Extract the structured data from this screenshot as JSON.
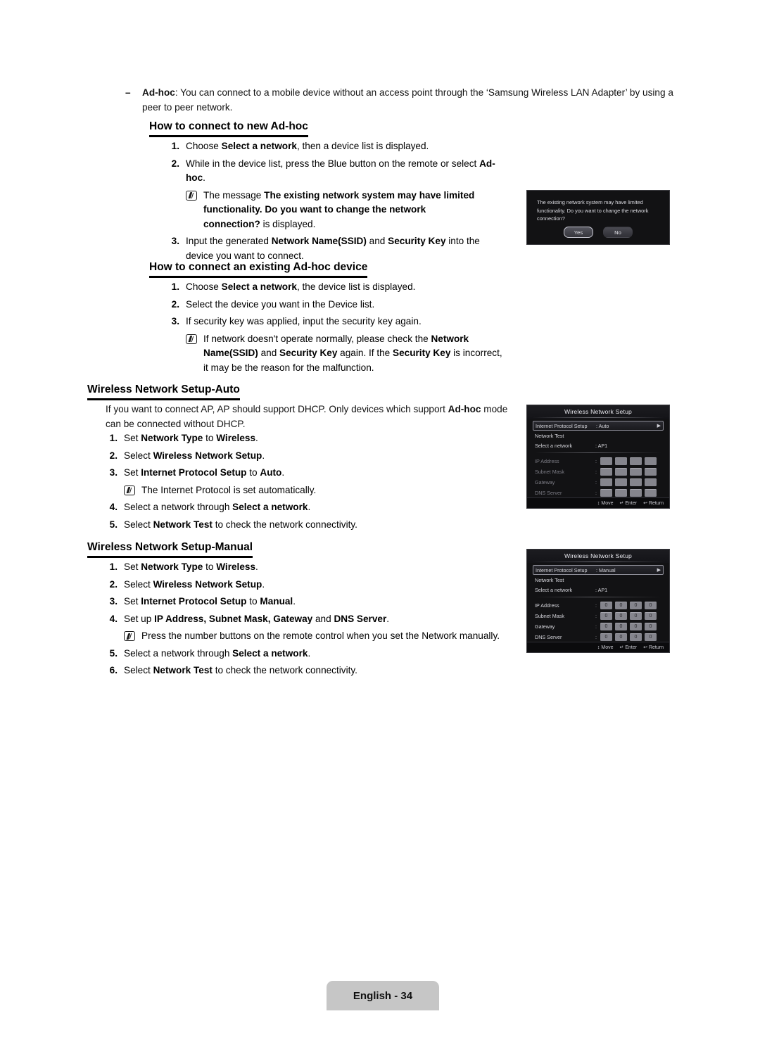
{
  "document": {
    "footer_label": "English - 34"
  },
  "intro": {
    "dash": "–",
    "term": "Ad-hoc",
    "text_1": ": You can connect to a mobile device without an access point through the ‘Samsung Wireless LAN Adapter’ by using a peer to peer network."
  },
  "section_new_adhoc": {
    "heading": "How to connect to new Ad-hoc",
    "items": [
      {
        "num": "1.",
        "parts": [
          {
            "t": "Choose ",
            "b": false
          },
          {
            "t": "Select a network",
            "b": true
          },
          {
            "t": ", then a device list is displayed.",
            "b": false
          }
        ]
      },
      {
        "num": "2.",
        "parts": [
          {
            "t": "While in the device list, press the Blue button on the remote or select ",
            "b": false
          },
          {
            "t": "Ad-hoc",
            "b": true
          },
          {
            "t": ".",
            "b": false
          }
        ]
      }
    ],
    "note": {
      "parts": [
        {
          "t": "The message ",
          "b": false
        },
        {
          "t": "The existing network system may have limited functionality. Do you want to change the network connection?",
          "b": true
        },
        {
          "t": " is displayed.",
          "b": false
        }
      ]
    },
    "item_3": {
      "num": "3.",
      "parts": [
        {
          "t": "Input the generated ",
          "b": false
        },
        {
          "t": "Network Name(SSID)",
          "b": true
        },
        {
          "t": " and ",
          "b": false
        },
        {
          "t": "Security Key",
          "b": true
        },
        {
          "t": " into the device you want to connect.",
          "b": false
        }
      ]
    }
  },
  "dialog": {
    "message": "The existing network system may have limited functionality. Do you want to change the network connection?",
    "buttons": [
      {
        "label": "Yes",
        "focused": true
      },
      {
        "label": "No",
        "focused": false
      }
    ]
  },
  "section_existing_adhoc": {
    "heading": "How to connect an existing Ad-hoc device",
    "items": [
      {
        "num": "1.",
        "parts": [
          {
            "t": "Choose ",
            "b": false
          },
          {
            "t": "Select a network",
            "b": true
          },
          {
            "t": ", the device list is displayed.",
            "b": false
          }
        ]
      },
      {
        "num": "2.",
        "parts": [
          {
            "t": "Select the device you want in the Device list.",
            "b": false
          }
        ]
      },
      {
        "num": "3.",
        "parts": [
          {
            "t": "If security key was applied, input the security key again.",
            "b": false
          }
        ]
      }
    ],
    "note": {
      "parts": [
        {
          "t": "If network doesn't operate normally, please check the ",
          "b": false
        },
        {
          "t": "Network Name(SSID)",
          "b": true
        },
        {
          "t": " and ",
          "b": false
        },
        {
          "t": "Security Key",
          "b": true
        },
        {
          "t": " again. If the ",
          "b": false
        },
        {
          "t": "Security Key",
          "b": true
        },
        {
          "t": " is incorrect, it may be the reason for the malfunction.",
          "b": false
        }
      ]
    }
  },
  "section_auto": {
    "heading": "Wireless Network Setup-Auto",
    "intro": [
      {
        "t": "If you want to connect AP, AP should support DHCP. Only devices which support ",
        "b": false
      },
      {
        "t": "Ad-hoc",
        "b": true
      },
      {
        "t": " mode can be connected without DHCP.",
        "b": false
      }
    ],
    "items": [
      {
        "num": "1.",
        "parts": [
          {
            "t": "Set ",
            "b": false
          },
          {
            "t": "Network Type",
            "b": true
          },
          {
            "t": " to ",
            "b": false
          },
          {
            "t": "Wireless",
            "b": true
          },
          {
            "t": ".",
            "b": false
          }
        ]
      },
      {
        "num": "2.",
        "parts": [
          {
            "t": "Select ",
            "b": false
          },
          {
            "t": "Wireless Network Setup",
            "b": true
          },
          {
            "t": ".",
            "b": false
          }
        ]
      },
      {
        "num": "3.",
        "parts": [
          {
            "t": "Set ",
            "b": false
          },
          {
            "t": "Internet Protocol Setup",
            "b": true
          },
          {
            "t": " to ",
            "b": false
          },
          {
            "t": "Auto",
            "b": true
          },
          {
            "t": ".",
            "b": false
          }
        ]
      }
    ],
    "note": {
      "parts": [
        {
          "t": "The Internet Protocol is set automatically.",
          "b": false
        }
      ]
    },
    "items_tail": [
      {
        "num": "4.",
        "parts": [
          {
            "t": "Select a network through ",
            "b": false
          },
          {
            "t": "Select a network",
            "b": true
          },
          {
            "t": ".",
            "b": false
          }
        ]
      },
      {
        "num": "5.",
        "parts": [
          {
            "t": "Select ",
            "b": false
          },
          {
            "t": "Network Test",
            "b": true
          },
          {
            "t": " to check the network connectivity.",
            "b": false
          }
        ]
      }
    ]
  },
  "section_manual": {
    "heading": "Wireless Network Setup-Manual",
    "items": [
      {
        "num": "1.",
        "parts": [
          {
            "t": "Set ",
            "b": false
          },
          {
            "t": "Network Type",
            "b": true
          },
          {
            "t": " to ",
            "b": false
          },
          {
            "t": "Wireless",
            "b": true
          },
          {
            "t": ".",
            "b": false
          }
        ]
      },
      {
        "num": "2.",
        "parts": [
          {
            "t": "Select ",
            "b": false
          },
          {
            "t": "Wireless Network Setup",
            "b": true
          },
          {
            "t": ".",
            "b": false
          }
        ]
      },
      {
        "num": "3.",
        "parts": [
          {
            "t": "Set ",
            "b": false
          },
          {
            "t": "Internet Protocol Setup",
            "b": true
          },
          {
            "t": " to ",
            "b": false
          },
          {
            "t": "Manual",
            "b": true
          },
          {
            "t": ".",
            "b": false
          }
        ]
      },
      {
        "num": "4.",
        "parts": [
          {
            "t": "Set up ",
            "b": false
          },
          {
            "t": "IP Address, Subnet Mask, Gateway",
            "b": true
          },
          {
            "t": " and ",
            "b": false
          },
          {
            "t": "DNS Server",
            "b": true
          },
          {
            "t": ".",
            "b": false
          }
        ]
      }
    ],
    "note": {
      "parts": [
        {
          "t": "Press the number buttons on the remote control when you set the Network manually.",
          "b": false
        }
      ]
    },
    "items_tail": [
      {
        "num": "5.",
        "parts": [
          {
            "t": "Select a network through ",
            "b": false
          },
          {
            "t": "Select a network",
            "b": true
          },
          {
            "t": ".",
            "b": false
          }
        ]
      },
      {
        "num": "6.",
        "parts": [
          {
            "t": "Select ",
            "b": false
          },
          {
            "t": "Network Test",
            "b": true
          },
          {
            "t": " to check the network connectivity.",
            "b": false
          }
        ]
      }
    ]
  },
  "osd_auto": {
    "title": "Wireless Network Setup",
    "rows": [
      {
        "label": "Internet Protocol Setup",
        "value": ": Auto",
        "selected": true,
        "arrow": "▶"
      },
      {
        "label": "Network Test",
        "value": "",
        "selected": false,
        "arrow": ""
      },
      {
        "label": "Select a network",
        "value": ": AP1",
        "selected": false,
        "arrow": ""
      }
    ],
    "grid_rows": [
      {
        "label": "IP Address",
        "values": [
          "",
          "",
          "",
          ""
        ]
      },
      {
        "label": "Subnet Mask",
        "values": [
          "",
          "",
          "",
          ""
        ]
      },
      {
        "label": "Gateway",
        "values": [
          "",
          "",
          "",
          ""
        ]
      },
      {
        "label": "DNS Server",
        "values": [
          "",
          "",
          "",
          ""
        ]
      }
    ],
    "footer": [
      {
        "key": "↕",
        "label": "Move"
      },
      {
        "key": "↵",
        "label": "Enter"
      },
      {
        "key": "↩",
        "label": "Return"
      }
    ]
  },
  "osd_manual": {
    "title": "Wireless Network Setup",
    "rows": [
      {
        "label": "Internet Protocol Setup",
        "value": ": Manual",
        "selected": true,
        "arrow": "▶"
      },
      {
        "label": "Network Test",
        "value": "",
        "selected": false,
        "arrow": ""
      },
      {
        "label": "Select a network",
        "value": ": AP1",
        "selected": false,
        "arrow": ""
      }
    ],
    "grid_rows": [
      {
        "label": "IP Address",
        "values": [
          "0",
          "0",
          "0",
          "0"
        ]
      },
      {
        "label": "Subnet Mask",
        "values": [
          "0",
          "0",
          "0",
          "0"
        ]
      },
      {
        "label": "Gateway",
        "values": [
          "0",
          "0",
          "0",
          "0"
        ]
      },
      {
        "label": "DNS Server",
        "values": [
          "0",
          "0",
          "0",
          "0"
        ]
      }
    ],
    "footer": [
      {
        "key": "↕",
        "label": "Move"
      },
      {
        "key": "↵",
        "label": "Enter"
      },
      {
        "key": "↩",
        "label": "Return"
      }
    ]
  }
}
